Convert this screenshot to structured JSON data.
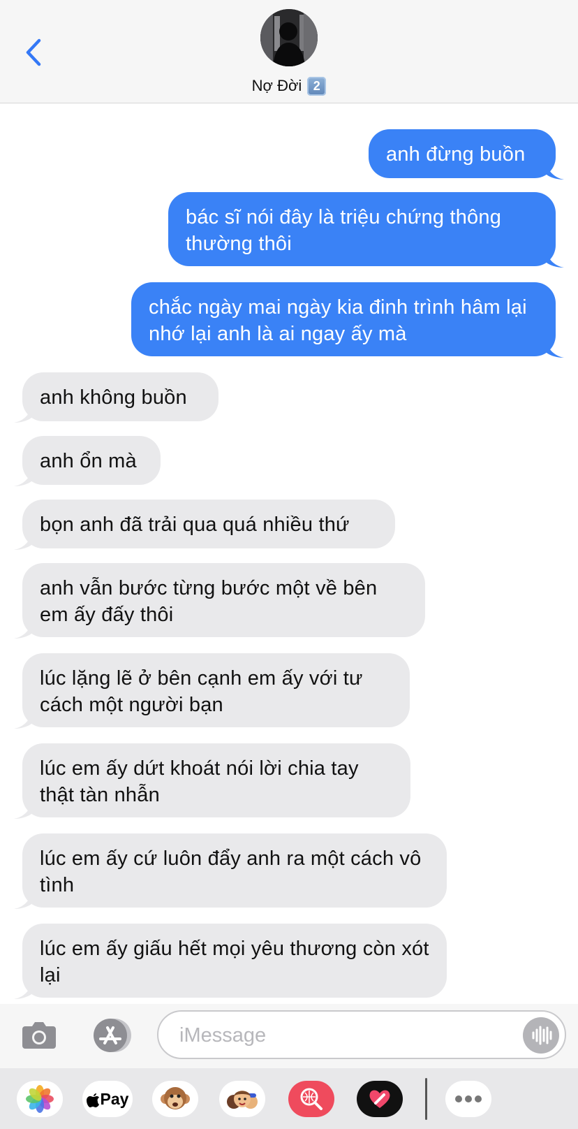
{
  "header": {
    "contact_name": "Nợ Đời",
    "badge": "2",
    "colors": {
      "back_chevron": "#3478f6"
    },
    "icons": {
      "back": "chevron-left-icon",
      "avatar": "contact-avatar"
    }
  },
  "messages": [
    {
      "direction": "outgoing",
      "text": "anh đừng buồn"
    },
    {
      "direction": "outgoing",
      "text": "bác sĩ nói đây là triệu chứng thông thường thôi"
    },
    {
      "direction": "outgoing",
      "text": "chắc ngày mai ngày kia đinh trình hâm lại nhớ lại anh là ai ngay ấy mà"
    },
    {
      "direction": "incoming",
      "text": "anh không buồn"
    },
    {
      "direction": "incoming",
      "text": "anh ổn mà"
    },
    {
      "direction": "incoming",
      "text": "bọn anh đã trải qua quá nhiều thứ"
    },
    {
      "direction": "incoming",
      "text": "anh vẫn bước từng bước một về bên em ấy đấy thôi"
    },
    {
      "direction": "incoming",
      "text": "lúc lặng lẽ ở bên cạnh em ấy với tư cách một người bạn"
    },
    {
      "direction": "incoming",
      "text": "lúc em ấy dứt khoát nói lời chia tay thật tàn nhẫn"
    },
    {
      "direction": "incoming",
      "text": "lúc em ấy cứ luôn đẩy anh ra một cách vô tình"
    },
    {
      "direction": "incoming",
      "text": "lúc em ấy giấu hết mọi yêu thương còn xót lại"
    }
  ],
  "input": {
    "placeholder": "iMessage",
    "value": "",
    "icons": {
      "camera": "camera-icon",
      "apps": "app-store-icon",
      "audio": "audio-waveform-icon"
    }
  },
  "app_drawer": {
    "apple_pay_label": "Pay",
    "apps": [
      "photos-icon",
      "apple-pay-icon",
      "monkey-memoji-icon",
      "memoji-stickers-icon",
      "image-search-icon",
      "digital-touch-icon",
      "more-icon"
    ]
  },
  "colors": {
    "outgoing_bubble": "#3a82f6",
    "incoming_bubble": "#e9e9eb",
    "header_bg": "#f6f6f6"
  }
}
